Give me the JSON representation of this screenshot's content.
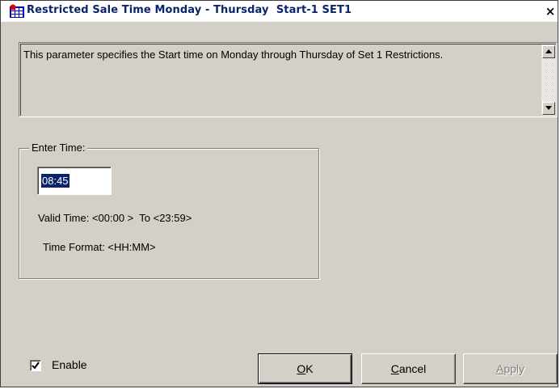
{
  "window": {
    "title": "Restricted Sale Time Monday - Thursday  Start-1 SET1",
    "close_glyph": "×",
    "icon": "app-grid-icon"
  },
  "description": {
    "text": "This parameter specifies the Start time on Monday through Thursday of Set 1 Restrictions."
  },
  "group": {
    "label": "Enter Time:",
    "time_value": "08:45",
    "valid_time": "Valid Time: <00:00 >  To <23:59>",
    "time_format": "Time Format: <HH:MM>"
  },
  "enable": {
    "label": "Enable",
    "checked": true
  },
  "buttons": {
    "ok": {
      "mnemonic": "O",
      "rest": "K"
    },
    "cancel": {
      "mnemonic": "C",
      "rest": "ancel"
    },
    "apply": {
      "mnemonic": "A",
      "rest": "pply",
      "disabled": true
    }
  },
  "colors": {
    "title_text": "#0a246a",
    "dialog_face": "#d4d0c8",
    "selection": "#0a246a"
  }
}
